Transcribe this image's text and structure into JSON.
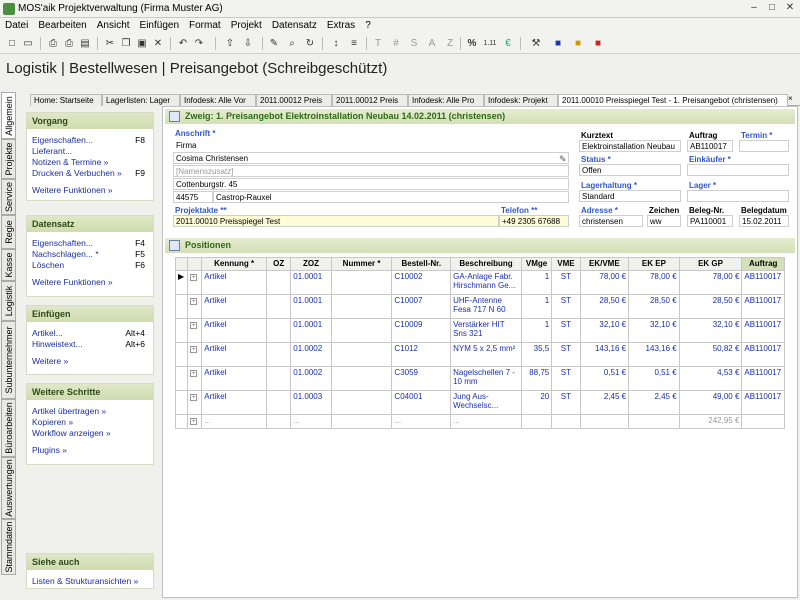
{
  "window": {
    "title": "MOS'aik Projektverwaltung (Firma Muster AG)"
  },
  "menu": [
    "Datei",
    "Bearbeiten",
    "Ansicht",
    "Einfügen",
    "Format",
    "Projekt",
    "Datensatz",
    "Extras",
    "?"
  ],
  "page_title": "Logistik | Bestellwesen | Preisangebot (Schreibgeschützt)",
  "vtabs": [
    "Allgemein",
    "Projekte",
    "Service",
    "Regie",
    "Kasse",
    "Logistik",
    "Subunternehmer",
    "Büroarbeiten",
    "Auswertungen",
    "Stammdaten"
  ],
  "content_tabs": [
    "Home: Startseite",
    "Lagerlisten: Lager",
    "Infodesk: Alle Vor",
    "2011.00012 Preis",
    "2011.00012 Preis",
    "Infodesk: Alle Pro",
    "Infodesk: Projekt",
    "2011.00010 Preisspiegel Test - 1. Preisangebot (christensen)"
  ],
  "sidebar": {
    "vorgang": {
      "title": "Vorgang",
      "items": [
        {
          "label": "Eigenschaften...",
          "key": "F8"
        },
        {
          "label": "Lieferant...",
          "key": ""
        },
        {
          "label": "Notizen & Termine »",
          "key": ""
        },
        {
          "label": "Drucken & Verbuchen »",
          "key": "F9"
        }
      ],
      "more": "Weitere Funktionen »"
    },
    "datensatz": {
      "title": "Datensatz",
      "items": [
        {
          "label": "Eigenschaften...",
          "key": "F4"
        },
        {
          "label": "Nachschlagen... *",
          "key": "F5"
        },
        {
          "label": "Löschen",
          "key": "F6"
        }
      ],
      "more": "Weitere Funktionen »"
    },
    "einfuegen": {
      "title": "Einfügen",
      "items": [
        {
          "label": "Artikel...",
          "key": "Alt+4"
        },
        {
          "label": "Hinweistext...",
          "key": "Alt+6"
        }
      ],
      "more": "Weitere »"
    },
    "schritte": {
      "title": "Weitere Schritte",
      "items": [
        {
          "label": "Artikel übertragen »",
          "key": ""
        },
        {
          "label": "Kopieren »",
          "key": ""
        },
        {
          "label": "Workflow anzeigen »",
          "key": ""
        }
      ],
      "more": "Plugins »"
    },
    "siehe": {
      "title": "Siehe auch",
      "items": [
        {
          "label": "Listen & Strukturansichten »",
          "key": ""
        }
      ]
    }
  },
  "header": {
    "title": "Zweig: 1. Preisangebot Elektroinstallation Neubau 14.02.2011 (christensen)",
    "anschrift_label": "Anschrift *",
    "anschrift": [
      "Firma",
      "Cosima Christensen",
      "[Namenszusatz]",
      "Cottenburgstr. 45"
    ],
    "plz": "44575",
    "ort": "Castrop-Rauxel",
    "kurztext_label": "Kurztext",
    "kurztext": "Elektroinstallation Neubau",
    "auftrag_label": "Auftrag",
    "auftrag": "AB110017",
    "termin_label": "Termin *",
    "termin": "",
    "status_label": "Status *",
    "status": "Offen",
    "einkaeufer_label": "Einkäufer *",
    "einkaeufer": "",
    "lagerhaltung_label": "Lagerhaltung *",
    "lagerhaltung": "Standard",
    "lager_label": "Lager *",
    "lager": "",
    "projektakte_label": "Projektakte **",
    "projektakte": "2011.00010 Preisspiegel Test",
    "telefon_label": "Telefon **",
    "telefon": "+49 2305 67688",
    "adresse_label": "Adresse *",
    "adresse": "christensen",
    "zeichen_label": "Zeichen",
    "zeichen": "ww",
    "belegnr_label": "Beleg-Nr.",
    "belegnr": "PA110001",
    "belegdatum_label": "Belegdatum",
    "belegdatum": "15.02.2011"
  },
  "positions": {
    "title": "Positionen",
    "columns": [
      "Kennung *",
      "OZ",
      "ZOZ",
      "Nummer *",
      "Bestell-Nr.",
      "Beschreibung",
      "VMge",
      "VME",
      "EK/VME",
      "EK EP",
      "EK GP",
      "Auftrag"
    ],
    "rows": [
      [
        "Artikel",
        "",
        "01.0001",
        "",
        "C10002",
        "GA-Anlage Fabr. Hirschmann Ge...",
        "1",
        "ST",
        "78,00 €",
        "78,00 €",
        "78,00 €",
        "AB110017"
      ],
      [
        "Artikel",
        "",
        "01.0001",
        "",
        "C10007",
        "UHF-Antenne Fesa 717 N 60",
        "1",
        "ST",
        "28,50 €",
        "28,50 €",
        "28,50 €",
        "AB110017"
      ],
      [
        "Artikel",
        "",
        "01.0001",
        "",
        "C10009",
        "Verstärker HIT Sns 321",
        "1",
        "ST",
        "32,10 €",
        "32,10 €",
        "32,10 €",
        "AB110017"
      ],
      [
        "Artikel",
        "",
        "01.0002",
        "",
        "C1012",
        "NYM 5 x 2,5 mm²",
        "35,5",
        "ST",
        "143,16 €",
        "143,16 €",
        "50,82 €",
        "AB110017"
      ],
      [
        "Artikel",
        "",
        "01.0002",
        "",
        "C3059",
        "Nagelschellen 7 - 10 mm",
        "88,75",
        "ST",
        "0,51 €",
        "0,51 €",
        "4,53 €",
        "AB110017"
      ],
      [
        "Artikel",
        "",
        "01.0003",
        "",
        "C04001",
        "Jung Aus-Wechselsc...",
        "20",
        "ST",
        "2,45 €",
        "2,45 €",
        "49,00 €",
        "AB110017"
      ],
      [
        "...",
        "",
        "...",
        "",
        "...",
        "...",
        "",
        "",
        "",
        "",
        "242,95 €",
        ""
      ]
    ]
  }
}
